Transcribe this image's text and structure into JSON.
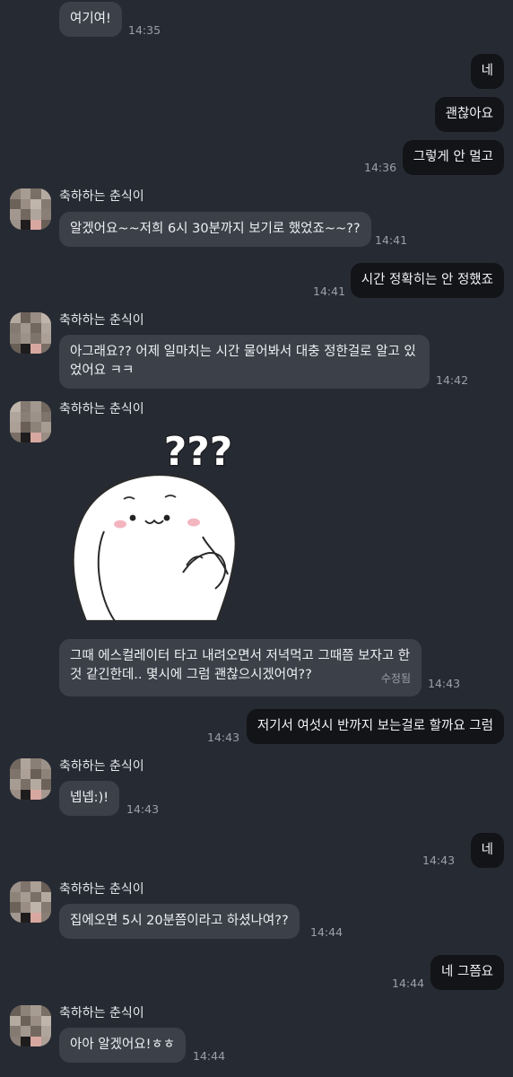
{
  "contact": {
    "name": "축하하는 춘식이"
  },
  "messages": [
    {
      "id": "m1",
      "side": "in",
      "text": "여기여!",
      "time": "14:35"
    },
    {
      "id": "m2",
      "side": "out",
      "text": "네",
      "time": ""
    },
    {
      "id": "m3",
      "side": "out",
      "text": "괜찮아요",
      "time": ""
    },
    {
      "id": "m4",
      "side": "out",
      "text": "그렇게 안 멀고",
      "time": "14:36"
    },
    {
      "id": "m5",
      "side": "in",
      "text": "알겠어요~~저희 6시 30분까지 보기로 했었죠~~??",
      "time": "14:41"
    },
    {
      "id": "m6",
      "side": "out",
      "text": "시간 정확히는 안 정했죠",
      "time": "14:41"
    },
    {
      "id": "m7",
      "side": "in",
      "text": "아그래요?? 어제 일마치는 시간 물어봐서 대충 정한걸로 알고 있었어요 ㅋㅋ",
      "time": "14:42"
    },
    {
      "id": "m8",
      "side": "in",
      "type": "sticker",
      "text": "???",
      "time": ""
    },
    {
      "id": "m9",
      "side": "in",
      "text": "그때 에스컬레이터 타고 내려오면서 저녁먹고 그때쯤 보자고 한 것 같긴한데.. 몇시에 그럼 괜찮으시겠어여??",
      "edited": "수정됨",
      "time": "14:43"
    },
    {
      "id": "m10",
      "side": "out",
      "text": "저기서 여섯시 반까지 보는걸로 할까요 그럼",
      "time": "14:43"
    },
    {
      "id": "m11",
      "side": "in",
      "text": "넵넵:)!",
      "time": "14:43"
    },
    {
      "id": "m12",
      "side": "out",
      "text": "네",
      "time": "14:43"
    },
    {
      "id": "m13",
      "side": "in",
      "text": "집에오면 5시 20분쯤이라고 하셨나여??",
      "time": "14:44"
    },
    {
      "id": "m14",
      "side": "out",
      "text": "네 그쯤요",
      "time": "14:44"
    },
    {
      "id": "m15",
      "side": "in",
      "text": "아아 알겠어요!ㅎㅎ",
      "time": "14:44"
    }
  ],
  "colors": {
    "background": "#262a33",
    "incoming_bubble": "#3c4049",
    "outgoing_bubble": "#121417",
    "time": "#9aa0a8"
  }
}
